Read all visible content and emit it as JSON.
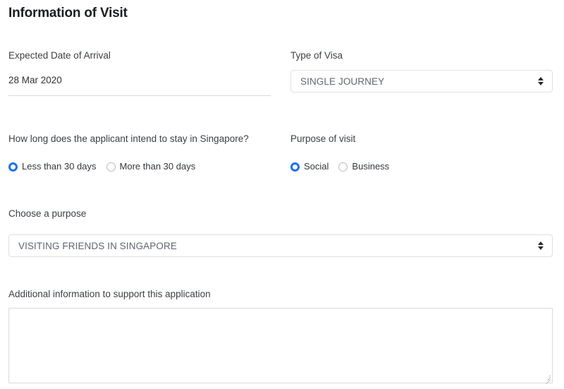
{
  "section": {
    "title": "Information of Visit"
  },
  "arrival": {
    "label": "Expected Date of Arrival",
    "value": "28 Mar 2020"
  },
  "visa_type": {
    "label": "Type of Visa",
    "selected": "SINGLE JOURNEY",
    "arrow_icon": "select-updown-arrow-icon"
  },
  "stay_duration": {
    "label": "How long does the applicant intend to stay in Singapore?",
    "options": [
      {
        "label": "Less than 30 days",
        "selected": true
      },
      {
        "label": "More than 30 days",
        "selected": false
      }
    ]
  },
  "purpose_of_visit": {
    "label": "Purpose of visit",
    "options": [
      {
        "label": "Social",
        "selected": true
      },
      {
        "label": "Business",
        "selected": false
      }
    ]
  },
  "choose_purpose": {
    "label": "Choose a purpose",
    "selected": "VISITING FRIENDS IN SINGAPORE",
    "arrow_icon": "select-updown-arrow-icon"
  },
  "additional_info": {
    "label": "Additional information to support this application",
    "value": "",
    "placeholder": ""
  },
  "colors": {
    "accent": "#1a73e8",
    "border": "#dfe1e5",
    "label_text": "#3c4043",
    "select_text": "#5f6670",
    "background": "#ffffff"
  }
}
